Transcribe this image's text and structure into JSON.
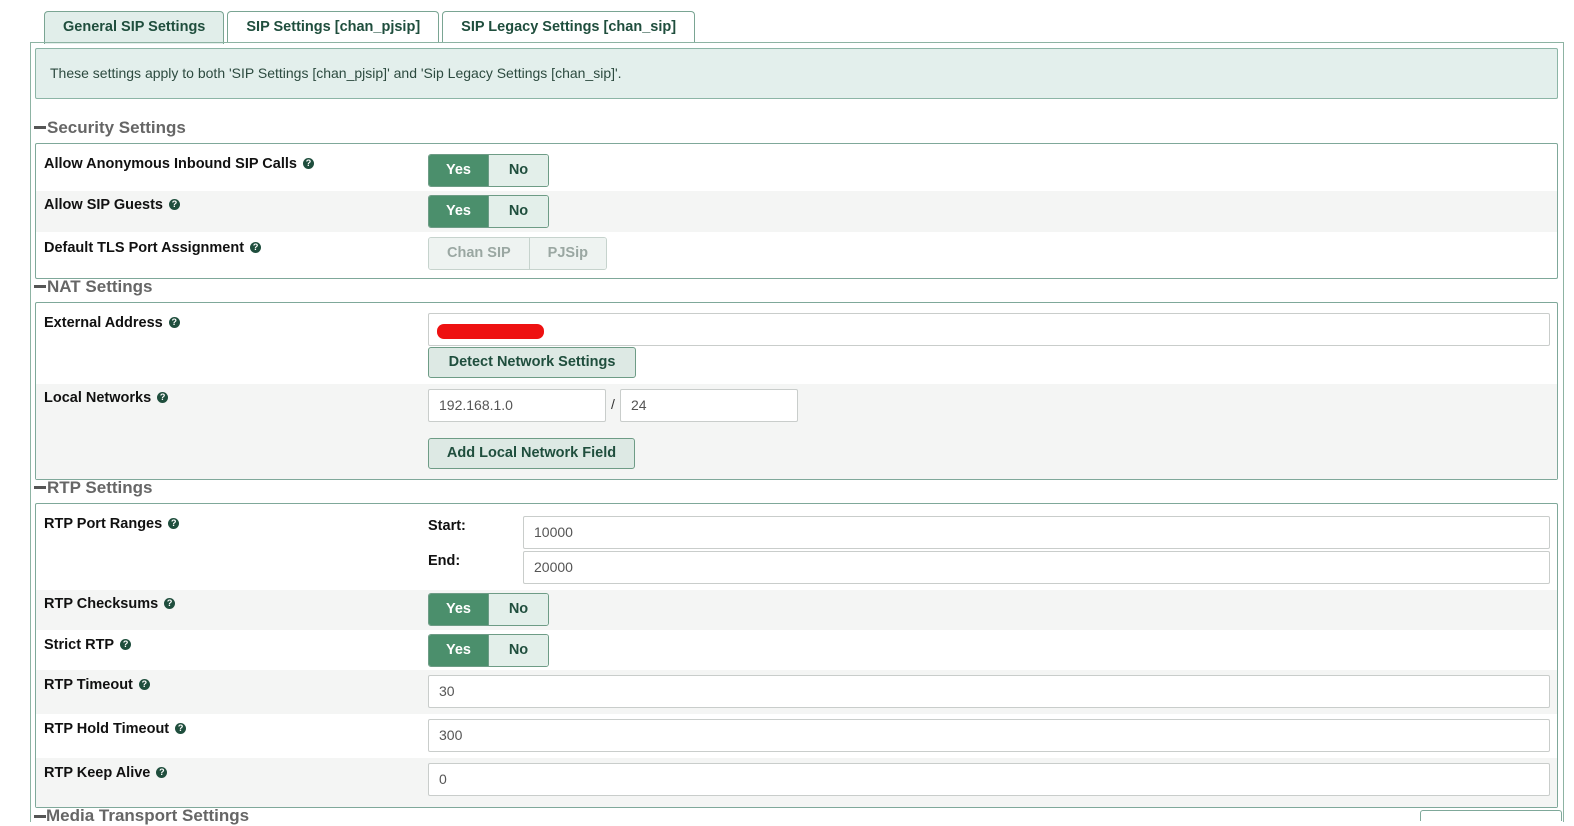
{
  "tabs": [
    {
      "label": "General SIP Settings",
      "active": true
    },
    {
      "label": "SIP Settings [chan_pjsip]",
      "active": false
    },
    {
      "label": "SIP Legacy Settings [chan_sip]",
      "active": false
    }
  ],
  "notice": "These settings apply to both 'SIP Settings [chan_pjsip]' and 'Sip Legacy Settings [chan_sip]'.",
  "security": {
    "title": "Security Settings",
    "anonymous": {
      "label": "Allow Anonymous Inbound SIP Calls",
      "yes": "Yes",
      "no": "No",
      "selected": "Yes"
    },
    "guests": {
      "label": "Allow SIP Guests",
      "yes": "Yes",
      "no": "No",
      "selected": "Yes"
    },
    "tls": {
      "label": "Default TLS Port Assignment",
      "opt1": "Chan SIP",
      "opt2": "PJSip"
    }
  },
  "nat": {
    "title": "NAT Settings",
    "external": {
      "label": "External Address",
      "value": ""
    },
    "detect_button": "Detect Network Settings",
    "local": {
      "label": "Local Networks",
      "network": "192.168.1.0",
      "separator": "/",
      "cidr": "24"
    },
    "add_button": "Add Local Network Field"
  },
  "rtp": {
    "title": "RTP Settings",
    "ports": {
      "label": "RTP Port Ranges",
      "start_label": "Start:",
      "start": "10000",
      "end_label": "End:",
      "end": "20000"
    },
    "checksums": {
      "label": "RTP Checksums",
      "yes": "Yes",
      "no": "No",
      "selected": "Yes"
    },
    "strict": {
      "label": "Strict RTP",
      "yes": "Yes",
      "no": "No",
      "selected": "Yes"
    },
    "timeout": {
      "label": "RTP Timeout",
      "value": "30"
    },
    "hold_timeout": {
      "label": "RTP Hold Timeout",
      "value": "300"
    },
    "keep_alive": {
      "label": "RTP Keep Alive",
      "value": "0"
    }
  },
  "next_section": {
    "title": "Media Transport Settings"
  },
  "help_glyph": "?",
  "colors": {
    "accent": "#4b8f6c",
    "border": "#7fa89a",
    "notice_bg": "#e3efec"
  }
}
